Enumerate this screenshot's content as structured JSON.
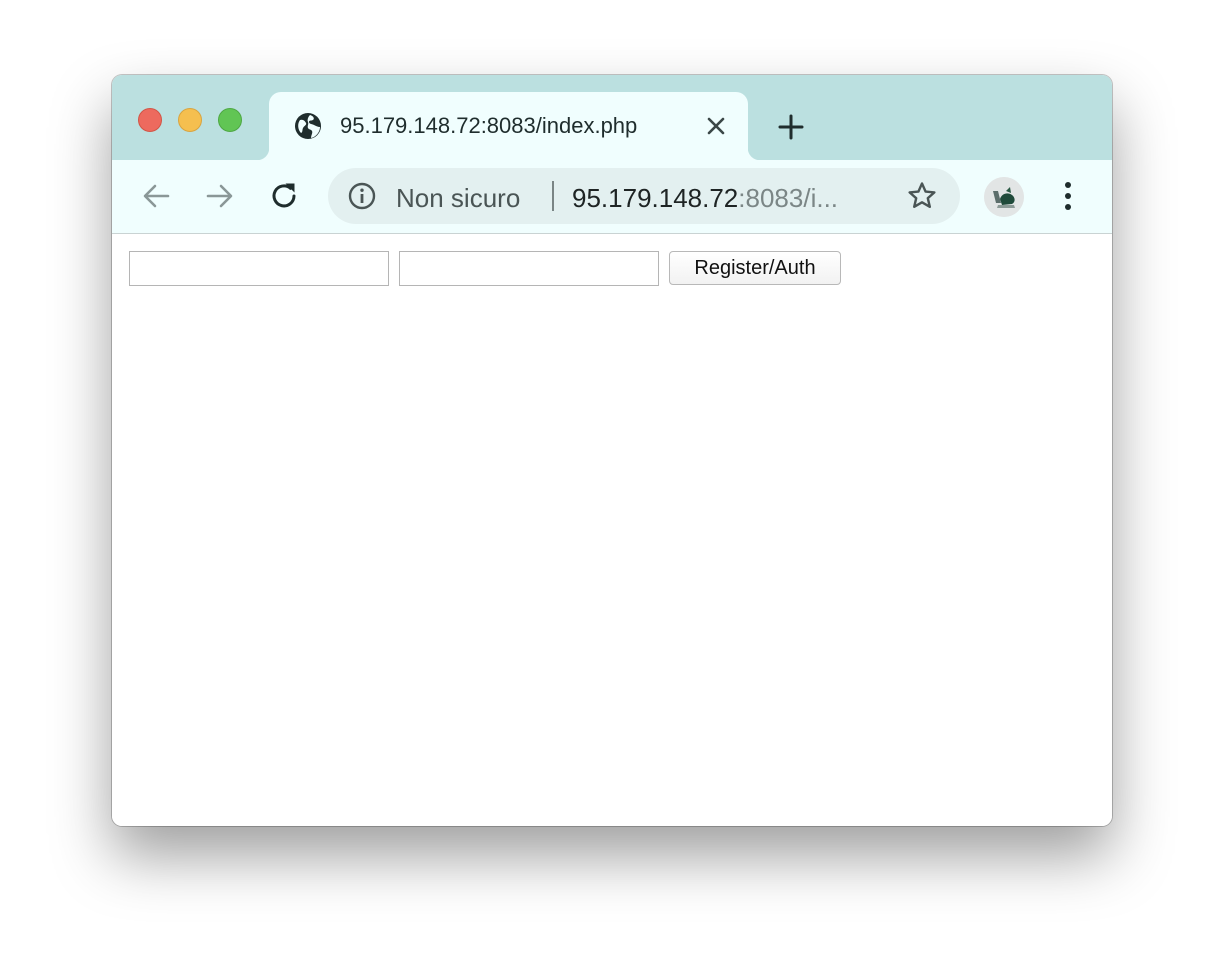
{
  "browser": {
    "tab": {
      "title": "95.179.148.72:8083/index.php",
      "favicon": "globe-icon",
      "close_icon": "close-icon"
    },
    "new_tab_icon": "plus-icon",
    "toolbar": {
      "back_icon": "arrow-left-icon",
      "forward_icon": "arrow-right-icon",
      "reload_icon": "reload-icon",
      "menu_icon": "kebab-menu-icon"
    },
    "omnibox": {
      "security_icon": "info-icon",
      "security_label": "Non sicuro",
      "url_host": "95.179.148.72",
      "url_rest": ":8083/i...",
      "bookmark_icon": "star-icon"
    },
    "profile_icon": "avatar"
  },
  "page": {
    "form": {
      "username_value": "",
      "password_value": "",
      "submit_label": "Register/Auth"
    }
  },
  "colors": {
    "titlebar": "#bbe0e0",
    "tab_active": "#f0fefe",
    "omnibox": "#e3f0f0"
  }
}
